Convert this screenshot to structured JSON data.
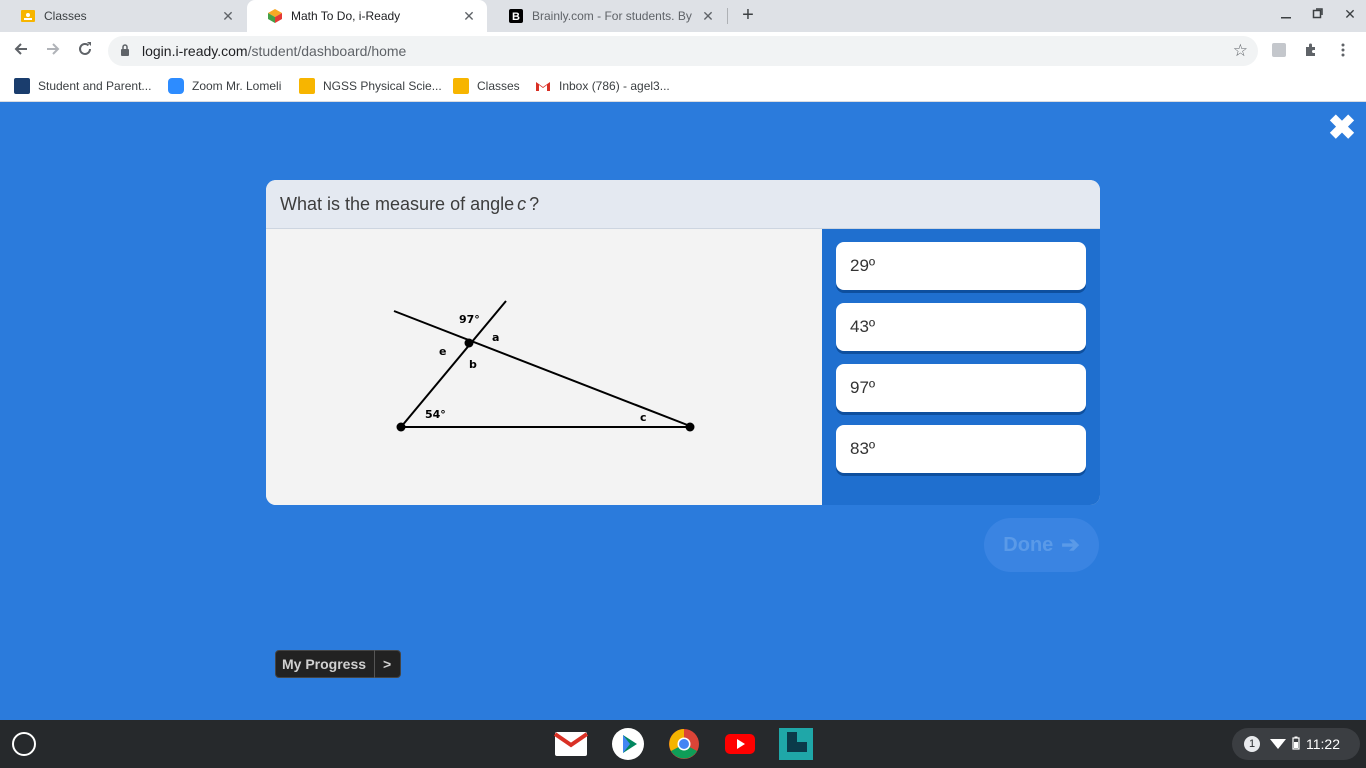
{
  "browser": {
    "tabs": [
      {
        "title": "Classes",
        "icon": "google-classroom-icon",
        "active": false
      },
      {
        "title": "Math To Do, i-Ready",
        "icon": "iready-icon",
        "active": true
      },
      {
        "title": "Brainly.com - For students. By st",
        "icon": "brainly-icon",
        "active": false
      }
    ],
    "close_glyph": "✕",
    "new_tab_glyph": "+",
    "url_host": "login.i-ready.com",
    "url_path": "/student/dashboard/home",
    "bookmarks": [
      {
        "label": "Student and Parent...",
        "icon": "portal-icon",
        "color": "#1a3d6d"
      },
      {
        "label": "Zoom Mr. Lomeli",
        "icon": "zoom-icon",
        "color": "#2d8cff"
      },
      {
        "label": "NGSS Physical Scie...",
        "icon": "google-classroom-icon",
        "color": "#f7b500"
      },
      {
        "label": "Classes",
        "icon": "google-classroom-icon",
        "color": "#f7b500"
      },
      {
        "label": "Inbox (786) - agel3...",
        "icon": "gmail-icon",
        "color": "#d93025"
      }
    ]
  },
  "question": {
    "prefix": "What is the measure of angle",
    "variable": "c",
    "suffix": "?"
  },
  "figure": {
    "labels": {
      "top_angle": "97°",
      "a": "a",
      "e": "e",
      "b": "b",
      "bottom_angle": "54°",
      "c": "c"
    }
  },
  "choices": [
    "29º",
    "43º",
    "97º",
    "83º"
  ],
  "done": {
    "label": "Done",
    "arrow": "➔"
  },
  "progress": {
    "label": "My Progress",
    "chevron": ">"
  },
  "close_glyph": "✖",
  "system": {
    "notification_count": "1",
    "time": "11:22"
  },
  "colors": {
    "page_background": "#2b7bdc",
    "choices_panel": "#1f6fcf",
    "done_disabled": "#3a84e2"
  }
}
